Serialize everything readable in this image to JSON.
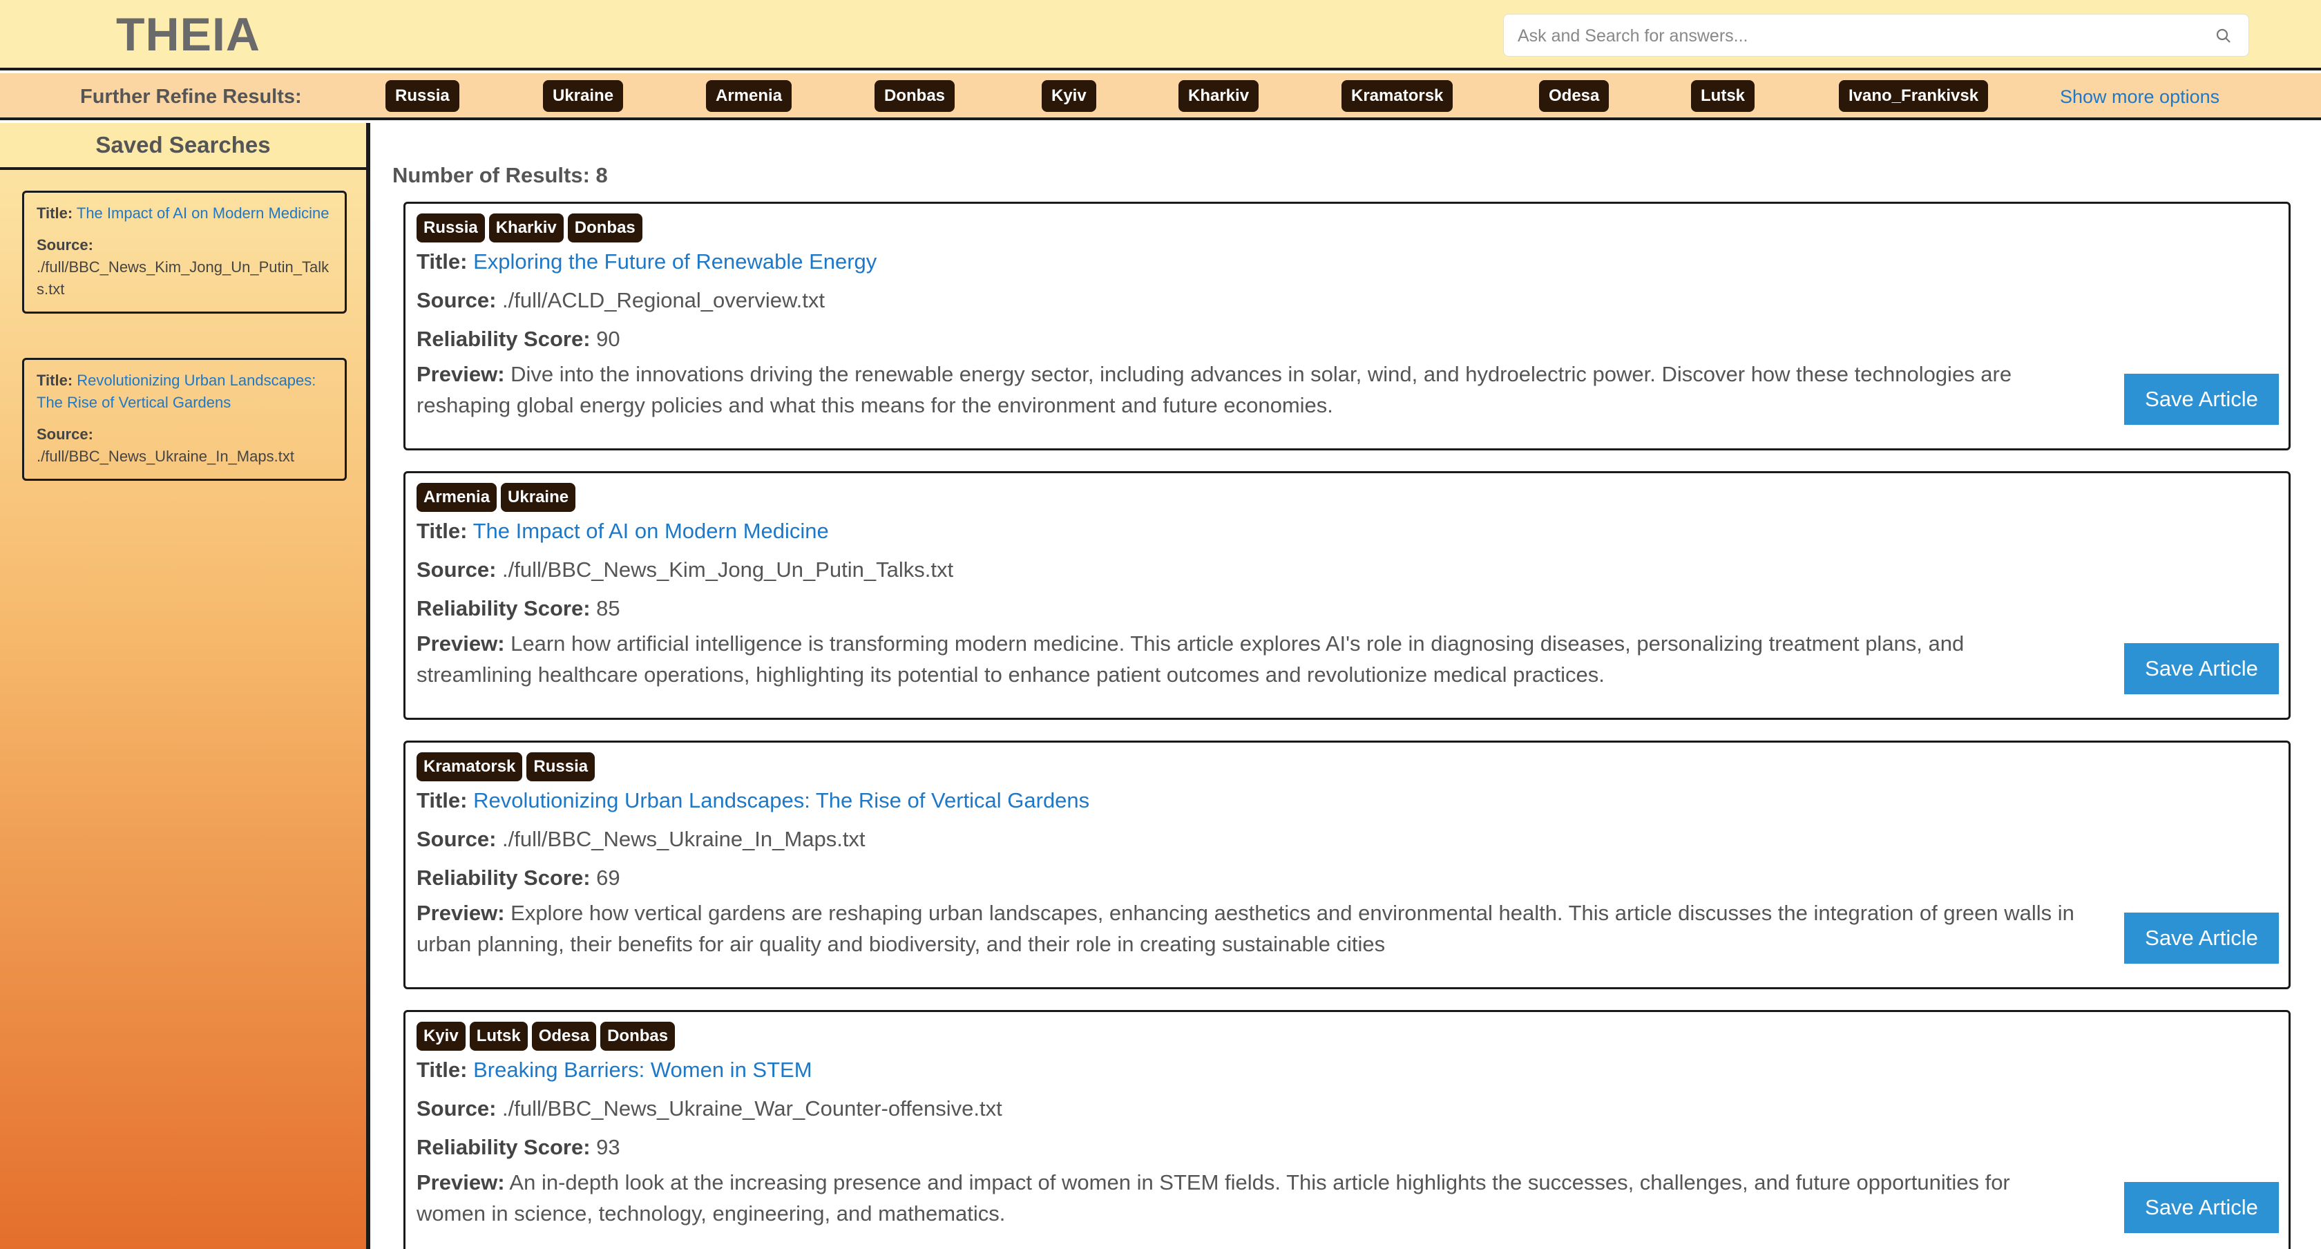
{
  "app": {
    "name": "THEIA"
  },
  "search": {
    "placeholder": "Ask and Search for answers..."
  },
  "refine": {
    "label": "Further Refine Results:",
    "tags": [
      "Russia",
      "Ukraine",
      "Armenia",
      "Donbas",
      "Kyiv",
      "Kharkiv",
      "Kramatorsk",
      "Odesa",
      "Lutsk",
      "Ivano_Frankivsk"
    ],
    "more": "Show more options"
  },
  "sidebar": {
    "title": "Saved Searches",
    "title_label": "Title:",
    "source_label": "Source:",
    "items": [
      {
        "title": "The Impact of AI on Modern Medicine",
        "source": "./full/BBC_News_Kim_Jong_Un_Putin_Talks.txt"
      },
      {
        "title": "Revolutionizing Urban Landscapes: The Rise of Vertical Gardens",
        "source": "./full/BBC_News_Ukraine_In_Maps.txt"
      }
    ]
  },
  "results": {
    "count_label": "Number of Results: 8",
    "title_label": "Title:",
    "source_label": "Source:",
    "score_label": "Reliability Score:",
    "preview_label": "Preview:",
    "save_label": "Save Article",
    "items": [
      {
        "tags": [
          "Russia",
          "Kharkiv",
          "Donbas"
        ],
        "title": "Exploring the Future of Renewable Energy",
        "source": "./full/ACLD_Regional_overview.txt",
        "score": "90",
        "preview": "Dive into the innovations driving the renewable energy sector, including advances in solar, wind, and hydroelectric power. Discover how these technologies are reshaping global energy policies and what this means for the environment and future economies."
      },
      {
        "tags": [
          "Armenia",
          "Ukraine"
        ],
        "title": "The Impact of AI on Modern Medicine",
        "source": "./full/BBC_News_Kim_Jong_Un_Putin_Talks.txt",
        "score": "85",
        "preview": "Learn how artificial intelligence is transforming modern medicine. This article explores AI's role in diagnosing diseases, personalizing treatment plans, and streamlining healthcare operations, highlighting its potential to enhance patient outcomes and revolutionize medical practices."
      },
      {
        "tags": [
          "Kramatorsk",
          "Russia"
        ],
        "title": "Revolutionizing Urban Landscapes: The Rise of Vertical Gardens",
        "source": "./full/BBC_News_Ukraine_In_Maps.txt",
        "score": "69",
        "preview": "Explore how vertical gardens are reshaping urban landscapes, enhancing aesthetics and environmental health. This article discusses the integration of green walls in urban planning, their benefits for air quality and biodiversity, and their role in creating sustainable cities"
      },
      {
        "tags": [
          "Kyiv",
          "Lutsk",
          "Odesa",
          "Donbas"
        ],
        "title": "Breaking Barriers: Women in STEM",
        "source": "./full/BBC_News_Ukraine_War_Counter-offensive.txt",
        "score": "93",
        "preview": "An in-depth look at the increasing presence and impact of women in STEM fields. This article highlights the successes, challenges, and future opportunities for women in science, technology, engineering, and mathematics."
      }
    ]
  }
}
